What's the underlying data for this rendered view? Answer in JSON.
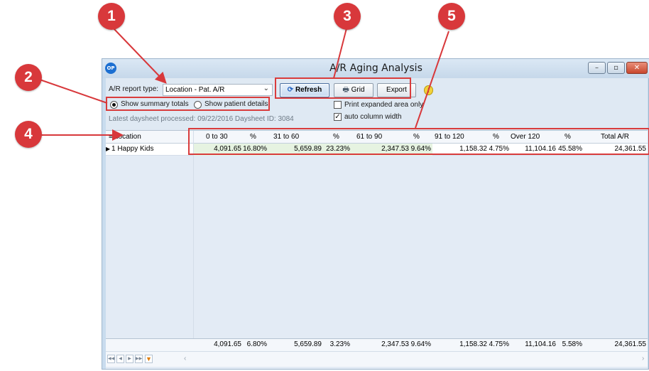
{
  "window": {
    "title": "A/R Aging Analysis",
    "app_icon": "OP",
    "controls": {
      "minimize": "–",
      "restore": "▫",
      "close": "✕"
    }
  },
  "toolbar": {
    "report_type_label": "A/R report type:",
    "report_type_value": "Location - Pat. A/R",
    "refresh_label": "Refresh",
    "grid_label": "Grid",
    "export_label": "Export",
    "show_summary_label": "Show summary totals",
    "show_patient_label": "Show patient details",
    "selected_view": "Show summary totals",
    "print_expanded_label": "Print expanded area only",
    "print_expanded_checked": false,
    "auto_column_label": "auto column width",
    "auto_column_checked": true,
    "daysheet_label": "Latest daysheet processed: 09/22/2016   Daysheet ID: 3084"
  },
  "grid": {
    "headers": [
      "Location",
      "0 to 30",
      "%",
      "31 to 60",
      "%",
      "61 to 90",
      "%",
      "91 to 120",
      "%",
      "Over 120",
      "%",
      "Total A/R"
    ],
    "rows": [
      [
        "1 Happy Kids",
        "4,091.65",
        "16.80%",
        "5,659.89",
        "23.23%",
        "2,347.53",
        "9.64%",
        "1,158.32",
        "4.75%",
        "11,104.16",
        "45.58%",
        "24,361.55"
      ]
    ],
    "footer": [
      "",
      "4,091.65",
      "6.80%",
      "5,659.89",
      "3.23%",
      "2,347.53",
      "9.64%",
      "1,158.32",
      "4.75%",
      "11,104.16",
      "5.58%",
      "24,361.55"
    ]
  },
  "callouts": [
    "1",
    "2",
    "3",
    "4",
    "5"
  ],
  "colors": {
    "callout": "#d8383b",
    "highlight_row": "#e6f3e1"
  }
}
